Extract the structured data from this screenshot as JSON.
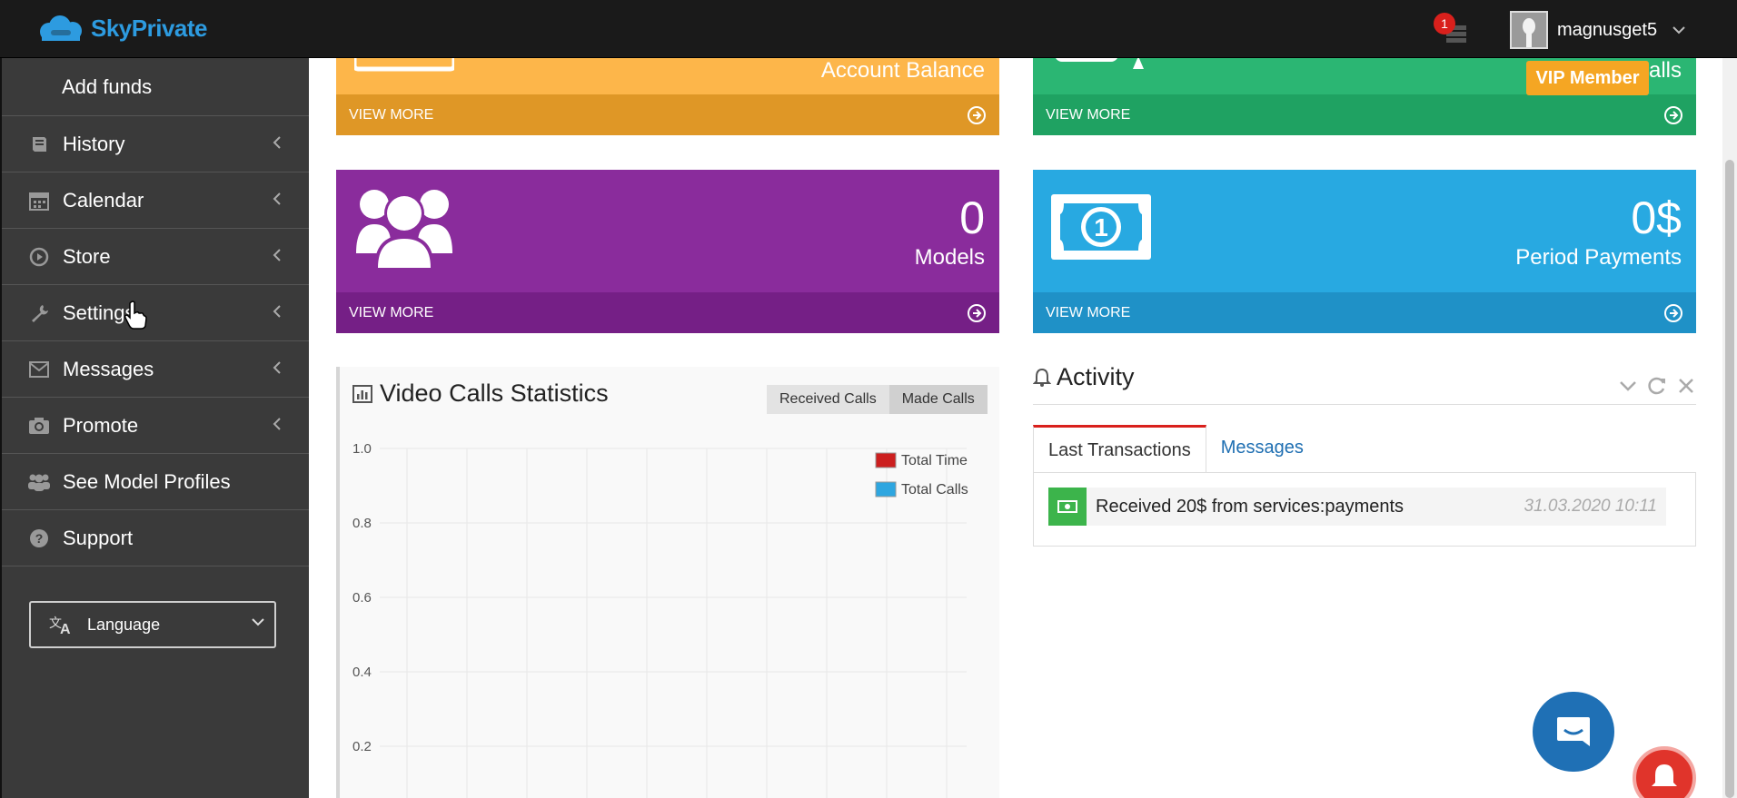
{
  "app": {
    "logo_text": "SkyPrivate",
    "brand_color": "#2d9be0"
  },
  "topbar": {
    "notification_count": "1",
    "username": "magnusget5"
  },
  "sidebar": {
    "sub_item": "Add funds",
    "items": [
      {
        "label": "History",
        "icon": "book-icon"
      },
      {
        "label": "Calendar",
        "icon": "calendar-icon"
      },
      {
        "label": "Store",
        "icon": "play-circle-icon"
      },
      {
        "label": "Settings",
        "icon": "wrench-icon"
      },
      {
        "label": "Messages",
        "icon": "envelope-icon"
      },
      {
        "label": "Promote",
        "icon": "camera-icon"
      },
      {
        "label": "See Model Profiles",
        "icon": "users-icon"
      },
      {
        "label": "Support",
        "icon": "question-circle-icon"
      }
    ],
    "language_label": "Language"
  },
  "cards": [
    {
      "label": "Account Balance",
      "footer": "VIEW MORE",
      "color": "#fdb64a",
      "footer_color": "#df9726"
    },
    {
      "label": "Calls",
      "footer": "VIEW MORE",
      "color": "#2bb673",
      "footer_color": "#1fa262"
    },
    {
      "value": "0",
      "label": "Models",
      "footer": "VIEW MORE",
      "color": "#8a2c9c",
      "footer_color": "#751f86"
    },
    {
      "value": "0$",
      "label": "Period Payments",
      "footer": "VIEW MORE",
      "color": "#28a9e1",
      "footer_color": "#1f91c7"
    }
  ],
  "vip_badge": "VIP Member",
  "video_calls": {
    "title": "Video Calls Statistics",
    "buttons": [
      "Received Calls",
      "Made Calls"
    ],
    "chart_data": {
      "type": "line",
      "y_ticks": [
        "1.0",
        "0.8",
        "0.6",
        "0.4",
        "0.2"
      ],
      "ylim": [
        0,
        1
      ],
      "grid": true,
      "legend": "top-right",
      "series": [
        {
          "name": "Total Time",
          "color": "#cc1f1f",
          "values": []
        },
        {
          "name": "Total Calls",
          "color": "#2ea6e0",
          "values": []
        }
      ]
    }
  },
  "activity": {
    "title": "Activity",
    "tabs": [
      "Last Transactions",
      "Messages"
    ],
    "transactions": [
      {
        "text": "Received 20$ from services:payments",
        "time": "31.03.2020 10:11"
      }
    ]
  }
}
